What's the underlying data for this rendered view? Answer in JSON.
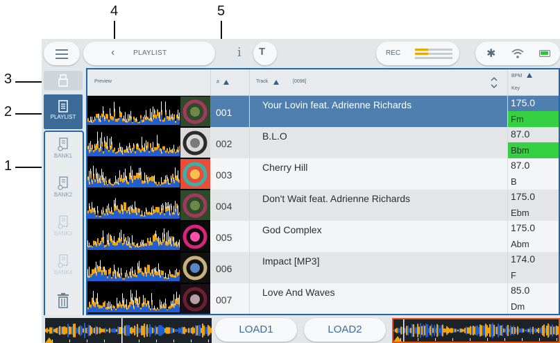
{
  "callouts": {
    "c1": "1",
    "c2": "2",
    "c3": "3",
    "c4": "4",
    "c5": "5"
  },
  "topbar": {
    "menu_icon": "hamburger-icon",
    "back_icon": "chevron-left-icon",
    "breadcrumb": "PLAYLIST",
    "info_icon": "info-icon",
    "filter_icon": "filter-icon",
    "rec_label": "REC",
    "rec_levels": [
      0.35,
      0.35,
      0.0
    ],
    "bluetooth_icon": "bluetooth-icon",
    "wifi_icon": "wifi-icon",
    "battery_icon": "battery-icon"
  },
  "sidebar": {
    "device_icon": "usb-device-icon",
    "playlist_label": "PLAYLIST",
    "banks": [
      {
        "label": "BANK1",
        "enabled": true
      },
      {
        "label": "BANK2",
        "enabled": true
      },
      {
        "label": "BANK3",
        "enabled": false
      },
      {
        "label": "BANK4",
        "enabled": false
      }
    ],
    "trash_icon": "trash-icon"
  },
  "table": {
    "headers": {
      "preview": "Preview",
      "number": "#",
      "track": "Track",
      "track_count": "[0096]",
      "bpm": "BPM",
      "key": "Key"
    },
    "rows": [
      {
        "num": "001",
        "title": "Your Lovin feat. Adrienne Richards",
        "bpm": "175.0",
        "key": "Fm",
        "key_highlight": true,
        "selected": true,
        "art_colors": [
          "#2f4a2b",
          "#a23a5e",
          "#6e8a46"
        ]
      },
      {
        "num": "002",
        "title": "B.L.O",
        "bpm": "87.0",
        "key": "Bbm",
        "key_highlight": true,
        "selected": false,
        "art_colors": [
          "#d9d9d9",
          "#2a2a2a",
          "#7a7a7a"
        ]
      },
      {
        "num": "003",
        "title": "Cherry Hill",
        "bpm": "87.0",
        "key": "B",
        "key_highlight": false,
        "selected": false,
        "art_colors": [
          "#e84d3a",
          "#3bb0a6",
          "#f2c14e"
        ]
      },
      {
        "num": "004",
        "title": "Don't Wait feat. Adrienne Richards",
        "bpm": "175.0",
        "key": "Ebm",
        "key_highlight": false,
        "selected": false,
        "art_colors": [
          "#2f4a2b",
          "#a23a5e",
          "#6e8a46"
        ]
      },
      {
        "num": "005",
        "title": "God Complex",
        "bpm": "175.0",
        "key": "Abm",
        "key_highlight": false,
        "selected": false,
        "art_colors": [
          "#0b0b0b",
          "#d8247a",
          "#ff4fa8"
        ]
      },
      {
        "num": "006",
        "title": "Impact [MP3]",
        "bpm": "174.0",
        "key": "F",
        "key_highlight": false,
        "selected": false,
        "art_colors": [
          "#111111",
          "#c9b27a",
          "#5a86c4"
        ]
      },
      {
        "num": "007",
        "title": "Love And Waves",
        "bpm": "85.0",
        "key": "Dm",
        "key_highlight": false,
        "selected": false,
        "art_colors": [
          "#1a0f14",
          "#6b2030",
          "#b8a0a6"
        ]
      }
    ]
  },
  "bottom": {
    "load1_label": "LOAD1",
    "load2_label": "LOAD2",
    "deck2_active_color": "#e8540a"
  },
  "colors": {
    "accent_blue": "#1f67b1",
    "selected_row": "#4f7fae",
    "key_green": "#36d143",
    "waveform_blue": "#1f5fd1",
    "waveform_orange": "#f0a30a"
  }
}
